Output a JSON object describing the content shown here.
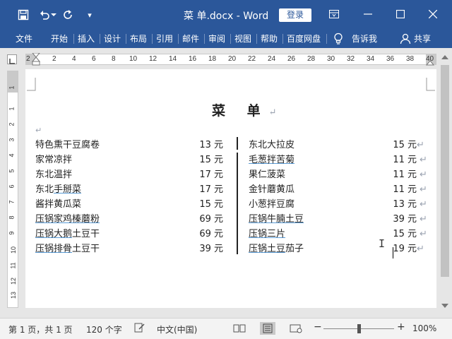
{
  "titlebar": {
    "doc_title": "菜 单.docx  -  Word",
    "login_label": "登录",
    "qat_more": "▾",
    "accent": "#2b579a"
  },
  "ribbon": {
    "tabs": [
      "文件",
      "开始",
      "插入",
      "设计",
      "布局",
      "引用",
      "邮件",
      "审阅",
      "视图",
      "帮助",
      "百度网盘"
    ],
    "tell_me": "告诉我",
    "share": "共享"
  },
  "ruler": {
    "h_numbers": [
      "2",
      "2",
      "4",
      "6",
      "8",
      "10",
      "12",
      "14",
      "16",
      "18",
      "20",
      "22",
      "24",
      "26",
      "28",
      "30",
      "32",
      "34",
      "36",
      "38",
      "40"
    ],
    "v_numbers": [
      "1",
      "1",
      "2",
      "3",
      "4",
      "5",
      "6",
      "7",
      "8",
      "9",
      "10",
      "11",
      "12",
      "13",
      "14"
    ]
  },
  "document": {
    "heading": "菜  单",
    "para_mark": "↵",
    "left_column": [
      {
        "name": "特色熏干豆腐卷",
        "price": "13 元",
        "underlined": false
      },
      {
        "name": "家常凉拌",
        "price": "15 元",
        "underlined": false
      },
      {
        "name": "东北温拌",
        "price": "17 元",
        "underlined": false
      },
      {
        "name": "东北手掰菜",
        "price": "17 元",
        "underlined": "part",
        "plain": "东北",
        "u": "手掰菜"
      },
      {
        "name": "酱拌黄瓜菜",
        "price": "15 元",
        "underlined": false
      },
      {
        "name": "压锅家鸡榛蘑粉",
        "price": "69 元",
        "underlined": "all"
      },
      {
        "name": "压锅大鹅土豆干",
        "price": "69 元",
        "underlined": "part",
        "plain": "",
        "u": "压锅大鹅",
        "rest": "土豆干"
      },
      {
        "name": "压锅排骨土豆干",
        "price": "39 元",
        "underlined": "part",
        "plain": "",
        "u": "压锅排骨",
        "rest": "土豆干"
      }
    ],
    "right_column": [
      {
        "name": "东北大拉皮",
        "price": "15 元",
        "underlined": false
      },
      {
        "name": "毛葱拌苦菊",
        "price": "11 元",
        "underlined": "all"
      },
      {
        "name": "果仁菠菜",
        "price": "11 元",
        "underlined": false
      },
      {
        "name": "金针蘑黄瓜",
        "price": "11 元",
        "underlined": false
      },
      {
        "name": "小葱拌豆腐",
        "price": "13 元",
        "underlined": false
      },
      {
        "name": "压锅牛腩土豆",
        "price": "39 元",
        "underlined": "all"
      },
      {
        "name": "压锅三片",
        "price": "15 元",
        "underlined": "all"
      },
      {
        "name": "压锅土豆茄子",
        "price": "19 元",
        "underlined": "part",
        "plain": "",
        "u": "压锅土豆",
        "rest": "茄子"
      }
    ]
  },
  "statusbar": {
    "page_info": "第 1 页，共 1 页",
    "word_count": "120 个字",
    "language": "中文(中国)",
    "zoom_minus": "−",
    "zoom_plus": "+",
    "zoom_level": "100%",
    "zoom_fraction": 0.5
  }
}
